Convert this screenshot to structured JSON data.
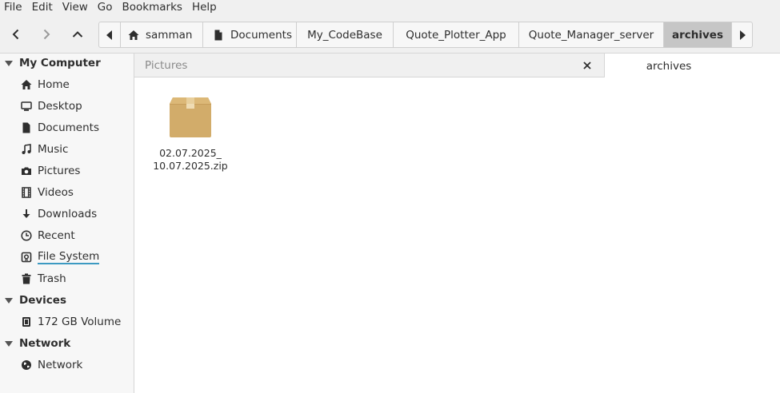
{
  "menubar": {
    "items": [
      "File",
      "Edit",
      "View",
      "Go",
      "Bookmarks",
      "Help"
    ]
  },
  "toolbar": {
    "back_icon": "chevron-left-icon",
    "forward_icon": "chevron-right-icon",
    "up_icon": "chevron-up-icon",
    "breadcrumbs": [
      "samman",
      "Documents",
      "My_CodeBase",
      "Quote_Plotter_App",
      "Quote_Manager_server",
      "archives"
    ],
    "active_crumb": "archives"
  },
  "sidebar": {
    "sections": [
      {
        "title": "My Computer",
        "items": [
          "Home",
          "Desktop",
          "Documents",
          "Music",
          "Pictures",
          "Videos",
          "Downloads",
          "Recent",
          "File System",
          "Trash"
        ]
      },
      {
        "title": "Devices",
        "items": [
          "172 GB Volume"
        ]
      },
      {
        "title": "Network",
        "items": [
          "Network"
        ]
      }
    ]
  },
  "tabs": {
    "inactive_label": "Pictures",
    "active_label": "archives"
  },
  "content": {
    "files": [
      {
        "name_line1": "02.07.2025_",
        "name_line2": "10.07.2025.zip",
        "icon": "package-icon"
      }
    ]
  },
  "colors": {
    "accent_underline": "#3d9ac2",
    "package": "#d2ac6a",
    "active_crumb_bg": "#c6c6c6"
  }
}
